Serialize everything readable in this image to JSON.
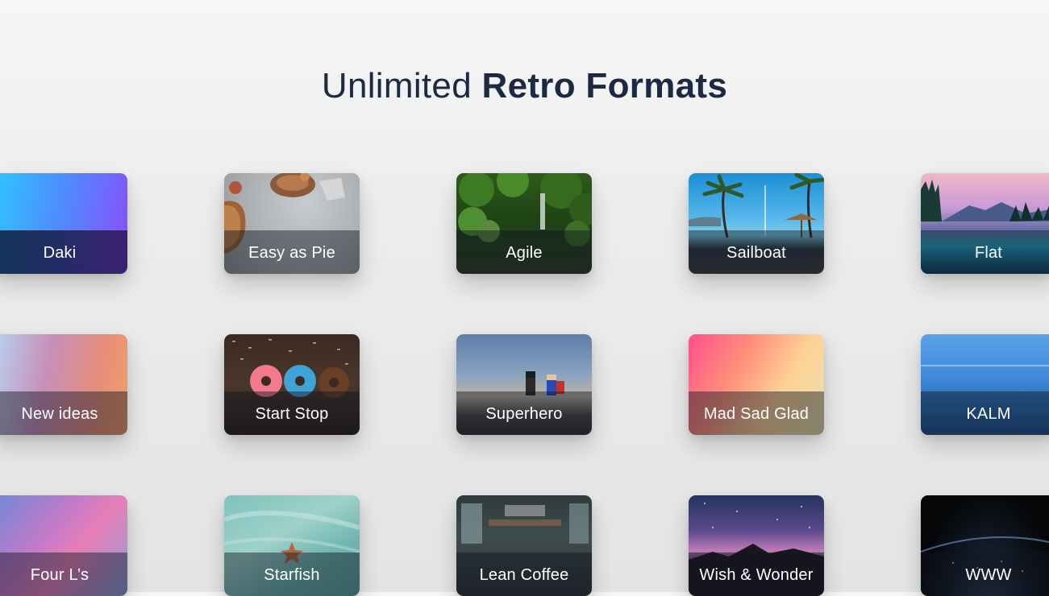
{
  "heading": {
    "light": "Unlimited",
    "bold": "Retro Formats"
  },
  "cards": [
    {
      "label": "Daki"
    },
    {
      "label": "Easy as Pie"
    },
    {
      "label": "Agile"
    },
    {
      "label": "Sailboat"
    },
    {
      "label": "Flat"
    },
    {
      "label": "New ideas"
    },
    {
      "label": "Start Stop"
    },
    {
      "label": "Superhero"
    },
    {
      "label": "Mad Sad Glad"
    },
    {
      "label": "KALM"
    },
    {
      "label": "Four L’s"
    },
    {
      "label": "Starfish"
    },
    {
      "label": "Lean Coffee"
    },
    {
      "label": "Wish & Wonder"
    },
    {
      "label": "WWW"
    }
  ]
}
